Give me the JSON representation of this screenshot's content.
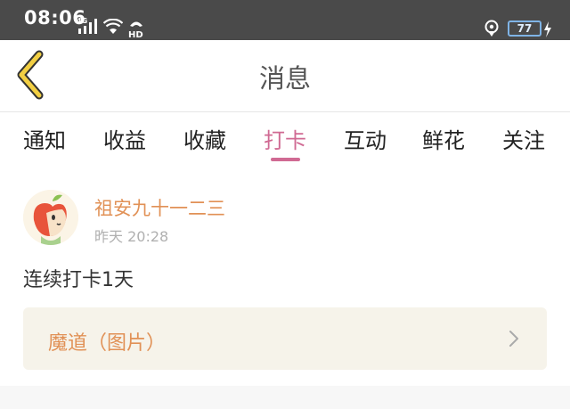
{
  "status_bar": {
    "time": "08:06",
    "network_label": "4G",
    "hd_label": "HD",
    "battery_level": "77"
  },
  "header": {
    "title": "消息",
    "back_icon": "chevron-left-icon"
  },
  "tabs": [
    {
      "label": "通知",
      "active": false
    },
    {
      "label": "收益",
      "active": false
    },
    {
      "label": "收藏",
      "active": false
    },
    {
      "label": "打卡",
      "active": true
    },
    {
      "label": "互动",
      "active": false
    },
    {
      "label": "鲜花",
      "active": false
    },
    {
      "label": "关注",
      "active": false
    }
  ],
  "post": {
    "username": "祖安九十一二三",
    "timestamp": "昨天 20:28",
    "text": "连续打卡1天",
    "link_card": {
      "label": "魔道（图片）"
    }
  },
  "colors": {
    "accent_pink": "#d06a93",
    "accent_orange": "#e19156",
    "back_arrow_yellow": "#f2cf43",
    "card_bg": "#f6f3ea"
  }
}
